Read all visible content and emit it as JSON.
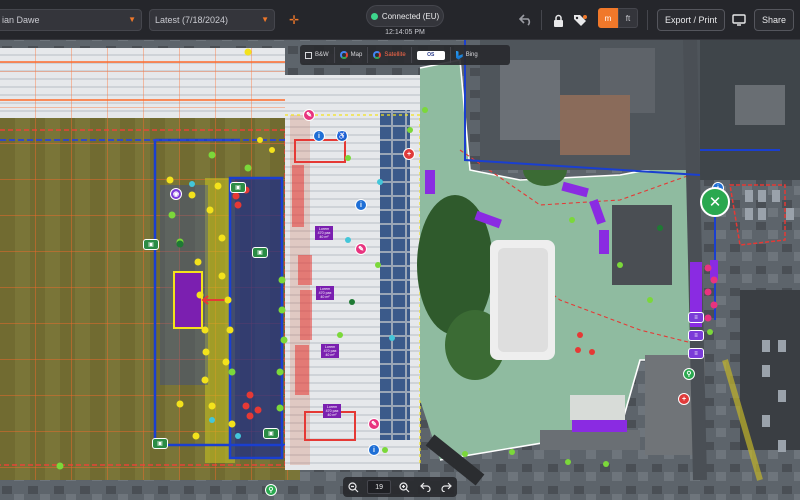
{
  "toolbar": {
    "user_select": "ian Dawe",
    "version_select": "Latest (7/18/2024)",
    "connection_status": "Connected (EU)",
    "clock": "12:14:05 PM",
    "unit_metric": "m",
    "unit_imperial": "ft",
    "export_label": "Export / Print",
    "share_label": "Share",
    "accent_color": "#f0782a",
    "status_color": "#3dd68c"
  },
  "map_layers": {
    "items": [
      {
        "label": "B&W",
        "icon": "square-icon"
      },
      {
        "label": "Map",
        "icon": "google-icon"
      },
      {
        "label": "Satellite",
        "icon": "google-icon",
        "active": true
      },
      {
        "label": "",
        "icon": "os-brand-icon"
      },
      {
        "label": "Bing",
        "icon": "bing-icon"
      }
    ]
  },
  "zoom": {
    "level": "19"
  },
  "venue_labels": [
    "Lorem\n470 pax\n40 m²",
    "Lorem\n470 pax\n40 m²",
    "Lorem\n470 pax\n40 m²",
    "Lorem\n470 pax\n40 m²"
  ],
  "map_colors": {
    "pitch_overlay": "#d9542b",
    "barrier_blue": "#1a3fd0",
    "pedestrian_area": "#9fc8a8",
    "building_roof": "#dfe2e6",
    "fence_red": "#e53935",
    "marker_purple": "#7b1fb0",
    "marker_yellow": "#f3e21c",
    "marker_green": "#7bd83a"
  }
}
